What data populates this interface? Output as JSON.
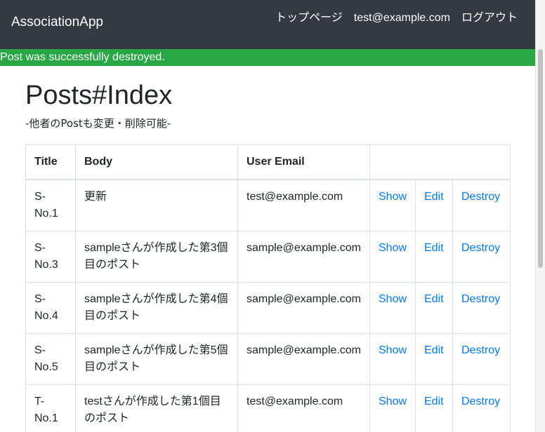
{
  "navbar": {
    "brand": "AssociationApp",
    "links": [
      "トップページ",
      "test@example.com",
      "ログアウト"
    ]
  },
  "flash": {
    "message": "Post was successfully destroyed.",
    "color": "#28a745"
  },
  "page": {
    "title": "Posts#Index",
    "subtitle": "-他者のPostも変更・削除可能-"
  },
  "table": {
    "headers": [
      "Title",
      "Body",
      "User Email",
      ""
    ],
    "rows": [
      {
        "title": "S-\nNo.1",
        "body": "更新",
        "email": "test@example.com"
      },
      {
        "title": "S-\nNo.3",
        "body": "sampleさんが作成した第3個目のポスト",
        "email": "sample@example.com"
      },
      {
        "title": "S-\nNo.4",
        "body": "sampleさんが作成した第4個目のポスト",
        "email": "sample@example.com"
      },
      {
        "title": "S-\nNo.5",
        "body": "sampleさんが作成した第5個目のポスト",
        "email": "sample@example.com"
      },
      {
        "title": "T-\nNo.1",
        "body": "testさんが作成した第1個目のポスト",
        "email": "test@example.com"
      }
    ],
    "actions": {
      "show": "Show",
      "edit": "Edit",
      "destroy": "Destroy"
    }
  },
  "colors": {
    "navbar_bg": "#343a40",
    "link": "#007bff"
  }
}
